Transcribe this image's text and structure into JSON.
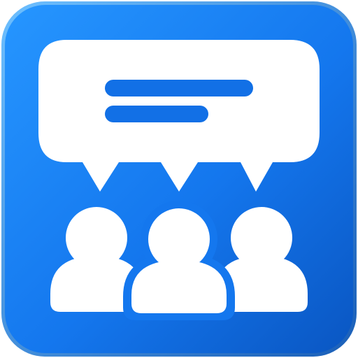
{
  "app_icon": {
    "name": "group-chat-app-icon",
    "colors": {
      "background_top": "#1a8cff",
      "background_bottom": "#0a5fcf",
      "glyph": "#ffffff",
      "message_lines": "#1270e6"
    },
    "icons": {
      "speech_bubble": "speech-bubble-icon",
      "people": [
        "person-icon",
        "person-icon",
        "person-icon"
      ]
    }
  }
}
